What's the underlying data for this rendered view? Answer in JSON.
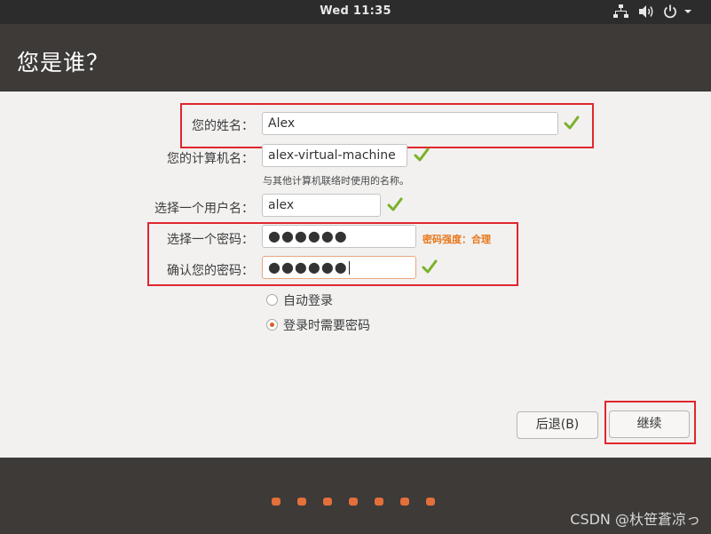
{
  "topbar": {
    "clock": "Wed 11:35",
    "icons": [
      "network-icon",
      "volume-icon",
      "power-icon",
      "menu-arrow-icon"
    ]
  },
  "header": {
    "title": "您是谁？"
  },
  "form": {
    "name": {
      "label": "您的姓名：",
      "value": "Alex",
      "valid": true
    },
    "computer": {
      "label": "您的计算机名：",
      "value": "alex-virtual-machine",
      "valid": true,
      "hint": "与其他计算机联络时使用的名称。"
    },
    "username": {
      "label": "选择一个用户名：",
      "value": "alex",
      "valid": true
    },
    "password": {
      "label": "选择一个密码：",
      "value": "●●●●●●",
      "strength": "密码强度：合理"
    },
    "confirm": {
      "label": "确认您的密码：",
      "value": "●●●●●●",
      "valid": true
    }
  },
  "login_options": {
    "auto": {
      "label": "自动登录",
      "selected": false
    },
    "require": {
      "label": "登录时需要密码",
      "selected": true
    }
  },
  "buttons": {
    "back": "后退(B)",
    "continue": "继续"
  },
  "progress": {
    "steps": 7
  },
  "watermark": "CSDN @杕笹蒼凉っ",
  "colors": {
    "accent": "#e36f3a",
    "highlight": "#e0262d",
    "check": "#7ab12a",
    "strength": "#e8771a"
  }
}
